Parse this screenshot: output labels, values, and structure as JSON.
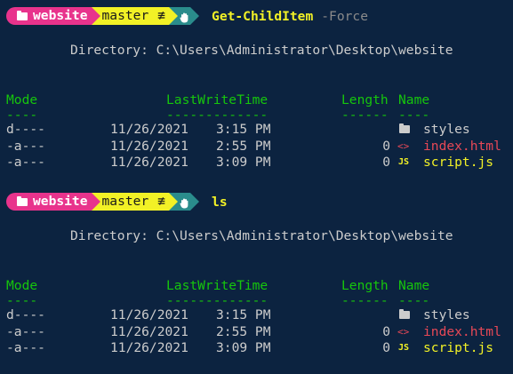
{
  "blocks": [
    {
      "prompt": {
        "path": "website",
        "branch": "master",
        "branch_status": "≢",
        "status_icon": "hand-icon",
        "command": "Get-ChildItem",
        "argument": "-Force"
      },
      "directory_line": "Directory: C:\\Users\\Administrator\\Desktop\\website",
      "headers": {
        "mode": "Mode",
        "lastwrite": "LastWriteTime",
        "length": "Length",
        "name": "Name"
      },
      "underlines": {
        "mode": "----",
        "lastwrite": "-------------",
        "length": "------",
        "name": "----"
      },
      "rows": [
        {
          "mode": "d----",
          "date": "11/26/2021",
          "time": "3:15 PM",
          "length": "",
          "icon": "folder-icon",
          "name": "styles",
          "kind": "dir"
        },
        {
          "mode": "-a---",
          "date": "11/26/2021",
          "time": "2:55 PM",
          "length": "0",
          "icon": "html-icon",
          "name": "index.html",
          "kind": "html"
        },
        {
          "mode": "-a---",
          "date": "11/26/2021",
          "time": "3:09 PM",
          "length": "0",
          "icon": "js-icon",
          "name": "script.js",
          "kind": "js"
        }
      ]
    },
    {
      "prompt": {
        "path": "website",
        "branch": "master",
        "branch_status": "≢",
        "status_icon": "hand-icon",
        "command": "ls",
        "argument": ""
      },
      "directory_line": "Directory: C:\\Users\\Administrator\\Desktop\\website",
      "headers": {
        "mode": "Mode",
        "lastwrite": "LastWriteTime",
        "length": "Length",
        "name": "Name"
      },
      "underlines": {
        "mode": "----",
        "lastwrite": "-------------",
        "length": "------",
        "name": "----"
      },
      "rows": [
        {
          "mode": "d----",
          "date": "11/26/2021",
          "time": "3:15 PM",
          "length": "",
          "icon": "folder-icon",
          "name": "styles",
          "kind": "dir"
        },
        {
          "mode": "-a---",
          "date": "11/26/2021",
          "time": "2:55 PM",
          "length": "0",
          "icon": "html-icon",
          "name": "index.html",
          "kind": "html"
        },
        {
          "mode": "-a---",
          "date": "11/26/2021",
          "time": "3:09 PM",
          "length": "0",
          "icon": "js-icon",
          "name": "script.js",
          "kind": "js"
        }
      ]
    }
  ],
  "glyphs": {
    "branch_symbol": "",
    "html_icon": "<>",
    "js_icon": "JS"
  },
  "colors": {
    "background": "#0c2340",
    "path_segment": "#e8338c",
    "git_segment": "#f2f126",
    "status_segment": "#2a8c8c",
    "header": "#16c60c",
    "html_file": "#e74856",
    "js_file": "#f2f126"
  }
}
